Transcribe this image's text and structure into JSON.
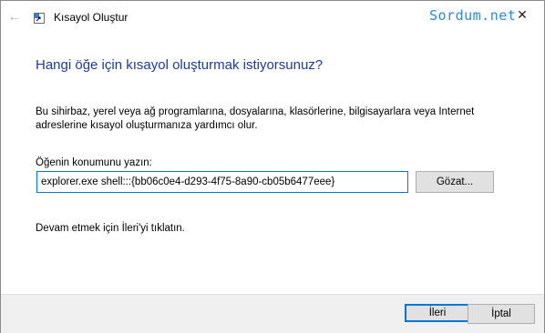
{
  "window": {
    "title": "Kısayol Oluştur",
    "watermark": "Sordum.net"
  },
  "content": {
    "heading": "Hangi öğe için kısayol oluşturmak istiyorsunuz?",
    "description": "Bu sihirbaz, yerel veya ağ programlarına, dosyalarına, klasörlerine, bilgisayarlara veya Internet adreslerine kısayol oluşturmanıza yardımcı olur.",
    "field_label": "Öğenin konumunu yazın:",
    "field_value": "explorer.exe shell:::{bb06c0e4-d293-4f75-8a90-cb05b6477eee}",
    "browse_label": "Gözat...",
    "hint": "Devam etmek için İleri'yi tıklatın."
  },
  "footer": {
    "next_label": "İleri",
    "cancel_label": "İptal"
  },
  "icons": {
    "back": "back-arrow-icon",
    "app": "shortcut-icon",
    "close": "close-icon"
  },
  "colors": {
    "heading": "#1a3b9e",
    "watermark": "#2a8ae0",
    "focus": "#0078d7"
  }
}
